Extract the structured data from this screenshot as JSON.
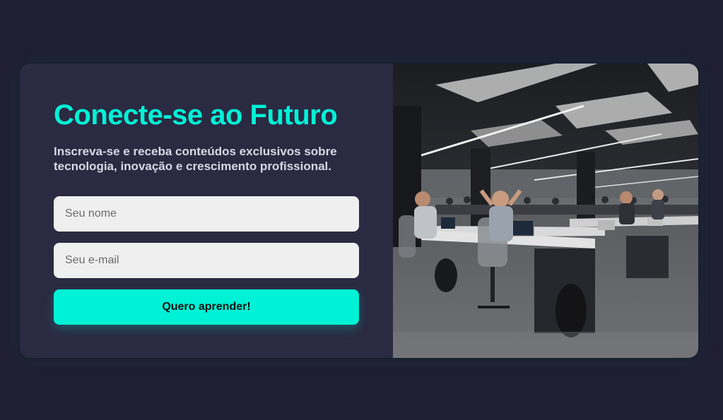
{
  "signup": {
    "headline": "Conecte-se ao Futuro",
    "subtext": "Inscreva-se e receba conteúdos exclusivos sobre tecnologia, inovação e crescimento profissional.",
    "name_placeholder": "Seu nome",
    "email_placeholder": "Seu e-mail",
    "submit_label": "Quero aprender!"
  },
  "colors": {
    "page_background": "#1f1f31",
    "card_background": "#2a2a42",
    "accent": "#00f2d6",
    "input_background": "#efefef"
  }
}
